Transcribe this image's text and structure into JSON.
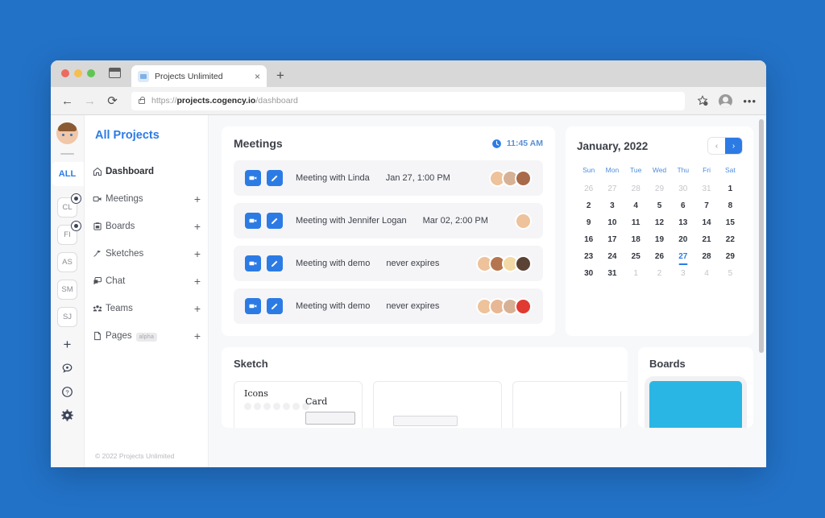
{
  "browser": {
    "tab_title": "Projects Unlimited",
    "tab_close": "×",
    "new_tab": "+",
    "back": "←",
    "forward": "→",
    "reload": "⟳",
    "url_prefix": "https://",
    "url_domain": "projects.cogency.io",
    "url_path": "/dashboard",
    "more_menu": "•••"
  },
  "rail": {
    "all_label": "ALL",
    "items": [
      {
        "label": "CL",
        "badge": true
      },
      {
        "label": "FI",
        "badge": true
      },
      {
        "label": "AS",
        "badge": false
      },
      {
        "label": "SM",
        "badge": false
      },
      {
        "label": "SJ",
        "badge": false
      }
    ],
    "add_label": "+"
  },
  "sidebar": {
    "title": "All Projects",
    "items": [
      {
        "label": "Dashboard",
        "icon": "home-icon",
        "add": false,
        "active": true
      },
      {
        "label": "Meetings",
        "icon": "video-icon",
        "add": true,
        "active": false
      },
      {
        "label": "Boards",
        "icon": "board-icon",
        "add": true,
        "active": false
      },
      {
        "label": "Sketches",
        "icon": "pen-icon",
        "add": true,
        "active": false
      },
      {
        "label": "Chat",
        "icon": "chat-icon",
        "add": true,
        "active": false
      },
      {
        "label": "Teams",
        "icon": "teams-icon",
        "add": true,
        "active": false
      },
      {
        "label": "Pages",
        "icon": "page-icon",
        "add": true,
        "active": false,
        "badge": "alpha"
      }
    ],
    "add_symbol": "+",
    "footer": "© 2022 Projects Unlimited"
  },
  "meetings": {
    "title": "Meetings",
    "time": "11:45 AM",
    "rows": [
      {
        "name": "Meeting with Linda",
        "when": "Jan 27, 1:00 PM",
        "avatars": [
          "#eec29a",
          "#d7b196",
          "#a86a4a"
        ]
      },
      {
        "name": "Meeting with Jennifer Logan",
        "when": "Mar 02, 2:00 PM",
        "avatars": [
          "#eec29a"
        ]
      },
      {
        "name": "Meeting with demo",
        "when": "never expires",
        "avatars": [
          "#eec29a",
          "#b5764f",
          "#f3d9a6",
          "#5a4335"
        ]
      },
      {
        "name": "Meeting with demo",
        "when": "never expires",
        "avatars": [
          "#eec29a",
          "#e8b894",
          "#d7b196",
          "#e03a32"
        ]
      }
    ],
    "video_icon": "video-camera-icon",
    "edit_icon": "pencil-icon"
  },
  "calendar": {
    "month": "January, 2022",
    "prev": "‹",
    "next": "›",
    "dow": [
      "Sun",
      "Mon",
      "Tue",
      "Wed",
      "Thu",
      "Fri",
      "Sat"
    ],
    "days": [
      {
        "n": "26",
        "mute": true
      },
      {
        "n": "27",
        "mute": true
      },
      {
        "n": "28",
        "mute": true
      },
      {
        "n": "29",
        "mute": true
      },
      {
        "n": "30",
        "mute": true
      },
      {
        "n": "31",
        "mute": true
      },
      {
        "n": "1"
      },
      {
        "n": "2"
      },
      {
        "n": "3"
      },
      {
        "n": "4"
      },
      {
        "n": "5"
      },
      {
        "n": "6"
      },
      {
        "n": "7"
      },
      {
        "n": "8"
      },
      {
        "n": "9"
      },
      {
        "n": "10"
      },
      {
        "n": "11"
      },
      {
        "n": "12"
      },
      {
        "n": "13"
      },
      {
        "n": "14"
      },
      {
        "n": "15"
      },
      {
        "n": "16"
      },
      {
        "n": "17"
      },
      {
        "n": "18"
      },
      {
        "n": "19"
      },
      {
        "n": "20"
      },
      {
        "n": "21"
      },
      {
        "n": "22"
      },
      {
        "n": "23"
      },
      {
        "n": "24"
      },
      {
        "n": "25"
      },
      {
        "n": "26"
      },
      {
        "n": "27",
        "sel": true
      },
      {
        "n": "28"
      },
      {
        "n": "29"
      },
      {
        "n": "30"
      },
      {
        "n": "31"
      },
      {
        "n": "1",
        "mute": true
      },
      {
        "n": "2",
        "mute": true
      },
      {
        "n": "3",
        "mute": true
      },
      {
        "n": "4",
        "mute": true
      },
      {
        "n": "5",
        "mute": true
      }
    ]
  },
  "sketch": {
    "title": "Sketch",
    "thumb_icons_label": "Icons",
    "thumb_card_label": "Card"
  },
  "boards": {
    "title": "Boards"
  },
  "colors": {
    "background": "#2272c8",
    "accent": "#2c7be5",
    "board_thumb": "#2ab6e4",
    "content_bg": "#f7f8fa"
  }
}
